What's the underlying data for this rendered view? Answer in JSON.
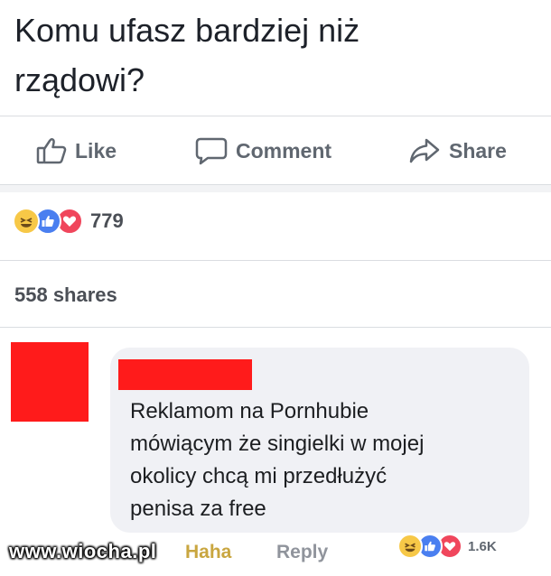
{
  "post": {
    "text_line1": "Komu ufasz bardziej niż",
    "text_line2": "rządowi?"
  },
  "actions": {
    "like_label": "Like",
    "comment_label": "Comment",
    "share_label": "Share"
  },
  "reactions": {
    "icons": [
      "haha-icon",
      "like-icon",
      "love-icon"
    ],
    "count": "779"
  },
  "shares_text": "558 shares",
  "comment": {
    "text_line1": "Reklamom na Pornhubie",
    "text_line2": "mówiącym że singielki w mojej",
    "text_line3": "okolicy chcą mi przedłużyć",
    "text_line4": "penisa za free",
    "haha_label": "Haha",
    "reply_label": "Reply",
    "reaction_count": "1.6K"
  },
  "watermark": "www.wiocha.pl",
  "colors": {
    "redaction": "#ff1b1b",
    "action_gray": "#606770",
    "bubble_bg": "#f0f1f5"
  }
}
